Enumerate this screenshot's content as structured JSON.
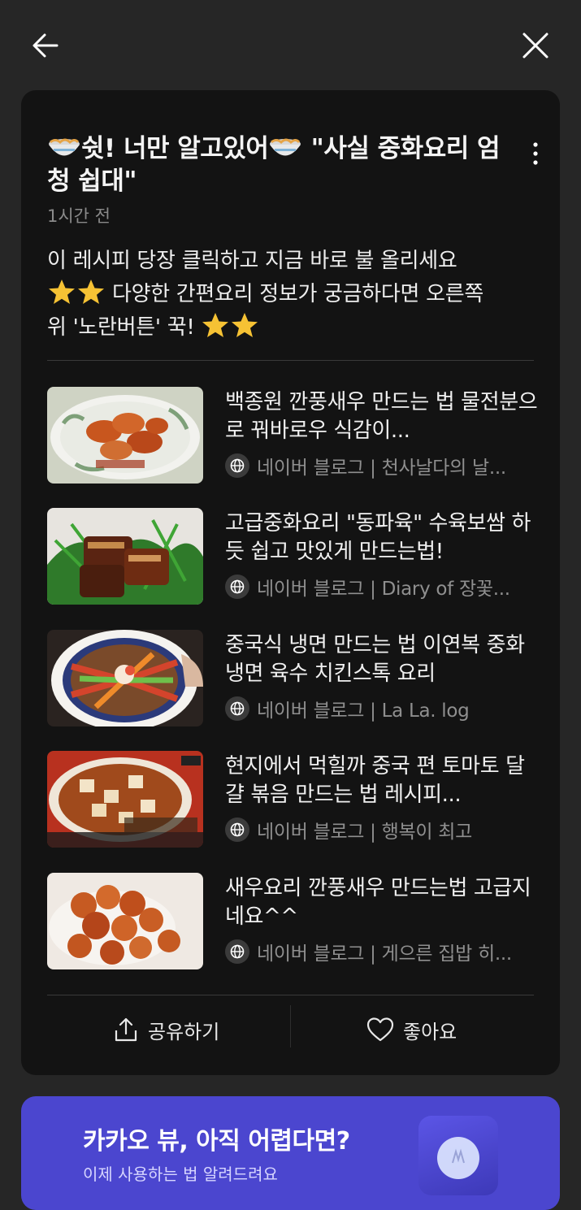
{
  "header": {
    "back_icon": "arrow-left-icon",
    "close_icon": "close-icon"
  },
  "post": {
    "title_part1": "쉿! 너만 알고있어",
    "title_part2": " \"사실 중화요리 엄청 쉽대\"",
    "emoji_icon": "noodle-bowl-emoji",
    "timestamp": "1시간 전",
    "desc_line1": "이 레시피 당장 클릭하고 지금 바로 불 올리세요",
    "desc_line2a": " 다양한 간편요리 정보가 궁금하다면 오른쪽",
    "desc_line3a": "위 '노란버튼' 꾹! ",
    "star_icon": "star-emoji"
  },
  "items": [
    {
      "title": "백종원 깐풍새우 만드는 법 물전분으로 꿔바로우 식감이...",
      "source": "네이버 블로그 | 천사날다의 날..."
    },
    {
      "title": "고급중화요리 \"동파육\" 수육보쌈 하듯 쉽고 맛있게 만드는법!",
      "source": "네이버 블로그 | Diary of 장꽃..."
    },
    {
      "title": "중국식 냉면 만드는 법 이연복 중화냉면 육수 치킨스톡 요리",
      "source": "네이버 블로그 | La La. log"
    },
    {
      "title": "현지에서 먹힐까 중국 편 토마토 달걀 볶음 만드는 법 레시피...",
      "source": "네이버 블로그 | 행복이 최고"
    },
    {
      "title": "새우요리 깐풍새우 만드는법 고급지네요^^",
      "source": "네이버 블로그 | 게으른 집밥 히..."
    }
  ],
  "actions": {
    "share_label": "공유하기",
    "like_label": "좋아요"
  },
  "banner": {
    "title": "카카오 뷰, 아직 어렵다면?",
    "subtitle": "이제 사용하는 법 알려드려요",
    "bg_color": "#4b46cf"
  }
}
